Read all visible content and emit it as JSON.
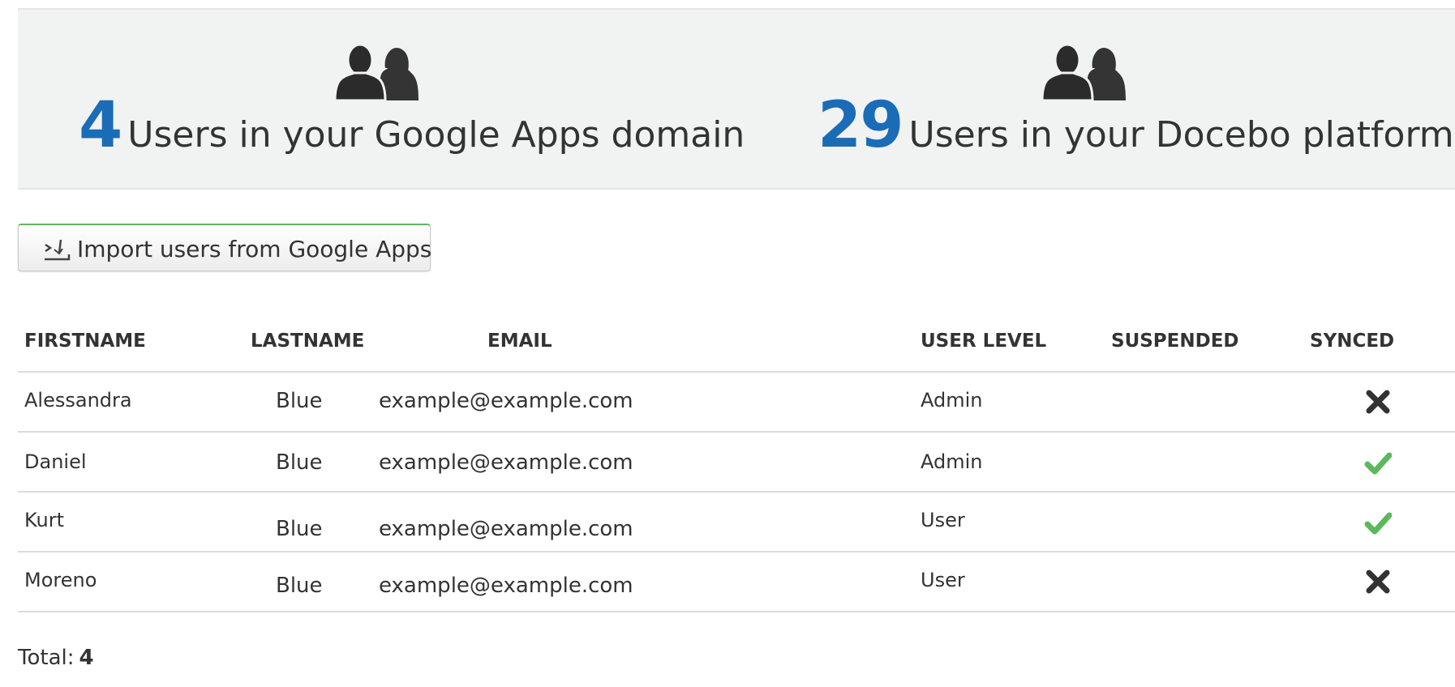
{
  "stats": {
    "google": {
      "icon": "users-group-icon",
      "count": "4",
      "text": "Users in your Google Apps domain"
    },
    "docebo": {
      "icon": "users-group-icon",
      "count": "29",
      "text": "Users in your Docebo platform"
    }
  },
  "import_button": {
    "label": "Import users from Google Apps",
    "icon": "import-icon"
  },
  "table": {
    "columns": {
      "firstname": "FIRSTNAME",
      "lastname": "LASTNAME",
      "email": "EMAIL",
      "user_level": "USER LEVEL",
      "suspended": "SUSPENDED",
      "synced": "SYNCED"
    },
    "rows": [
      {
        "firstname": "Alessandra",
        "lastname": "Blue",
        "email": "example@example.com",
        "user_level": "Admin",
        "suspended": "",
        "synced": false
      },
      {
        "firstname": "Daniel",
        "lastname": "Blue",
        "email": "example@example.com",
        "user_level": "Admin",
        "suspended": "",
        "synced": true
      },
      {
        "firstname": "Kurt",
        "lastname": "Blue",
        "email": "example@example.com",
        "user_level": "User",
        "suspended": "",
        "synced": true
      },
      {
        "firstname": "Moreno",
        "lastname": "Blue",
        "email": "example@example.com",
        "user_level": "User",
        "suspended": "",
        "synced": false
      }
    ]
  },
  "total": {
    "label": "Total:",
    "value": "4"
  },
  "colors": {
    "accent_blue": "#1a6cb7",
    "synced_green": "#5cb85c",
    "not_synced_dark": "#333333",
    "panel_bg": "#f1f2f2"
  }
}
